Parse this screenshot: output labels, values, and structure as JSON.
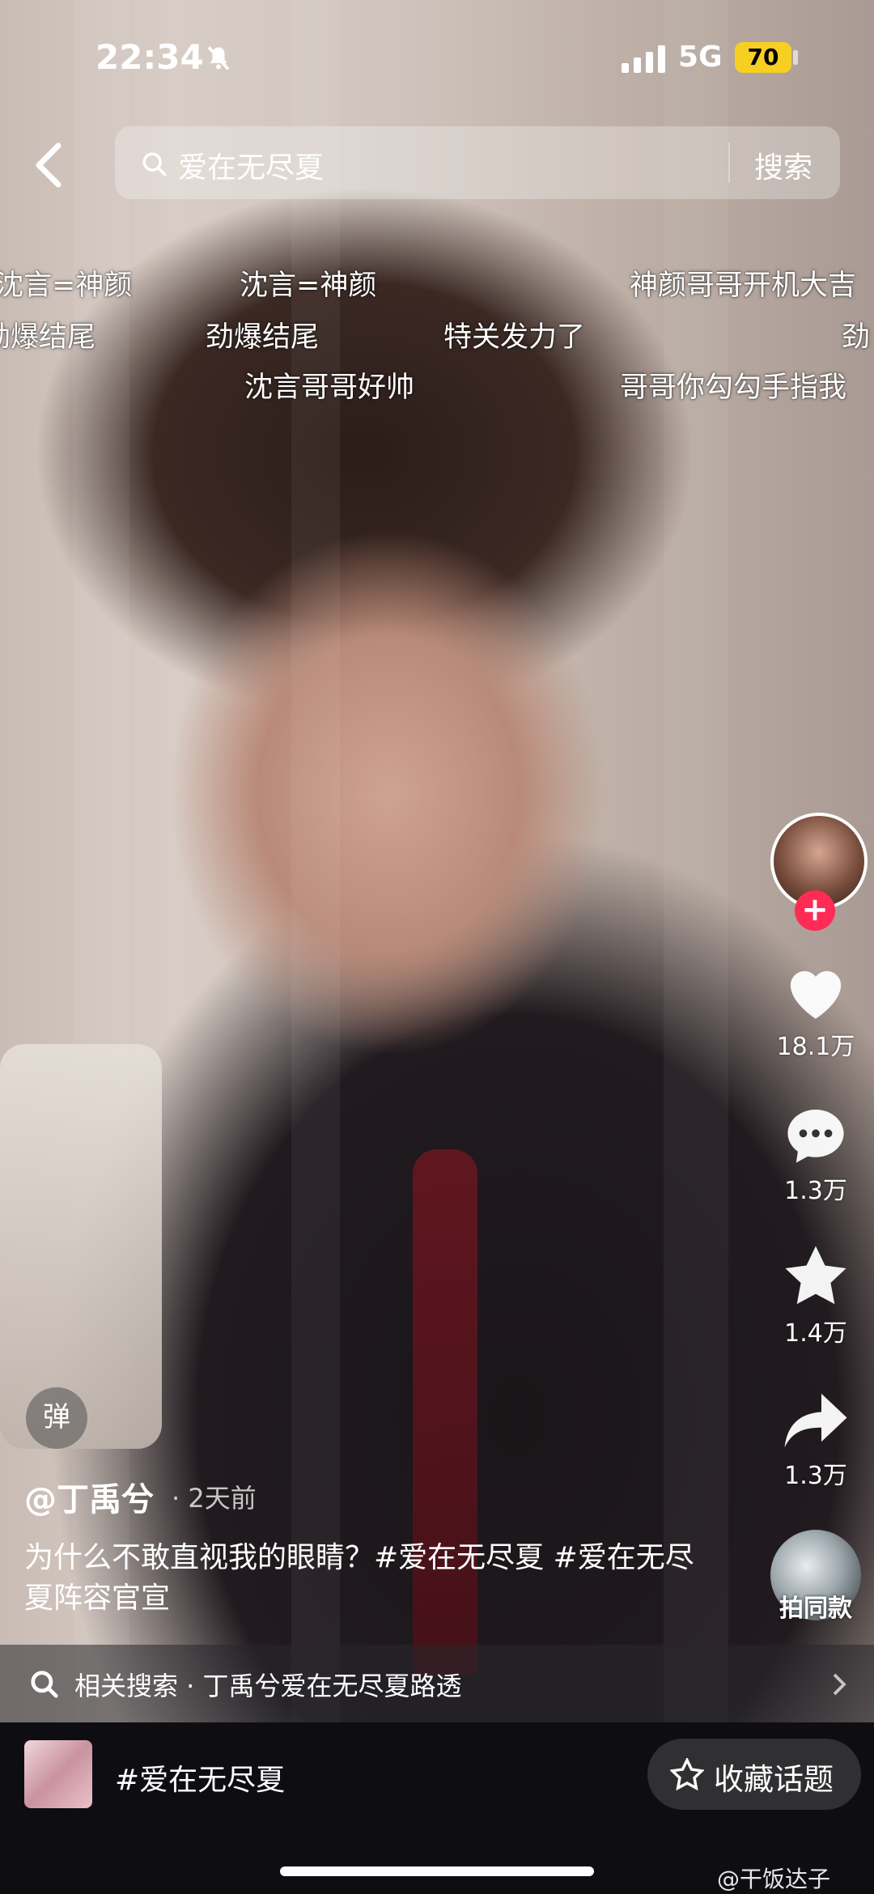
{
  "status": {
    "time": "22:34",
    "network": "5G",
    "battery": "70"
  },
  "search": {
    "query": "爱在无尽夏",
    "button": "搜索"
  },
  "danmaku": [
    "沈言=神颜",
    "沈言=神颜",
    "神颜哥哥开机大吉",
    "劲爆结尾",
    "劲爆结尾",
    "特关发力了",
    "劲",
    "沈言哥哥好帅",
    "哥哥你勾勾手指我"
  ],
  "actions": {
    "like_count": "18.1万",
    "comment_count": "1.3万",
    "favorite_count": "1.4万",
    "share_count": "1.3万",
    "same_style_label": "拍同款",
    "danmaku_toggle": "弹"
  },
  "video": {
    "author": "@丁禹兮",
    "time_ago": "· 2天前",
    "caption": "为什么不敢直视我的眼睛？#爱在无尽夏 #爱在无尽夏阵容官宣"
  },
  "related_search": {
    "text": "相关搜索 · 丁禹兮爱在无尽夏路透"
  },
  "topic_bar": {
    "topic": "#爱在无尽夏",
    "collect_label": "收藏话题"
  },
  "watermark": "@干饭达子",
  "colors": {
    "follow": "#fe2c55",
    "battery": "#f7cf23"
  }
}
